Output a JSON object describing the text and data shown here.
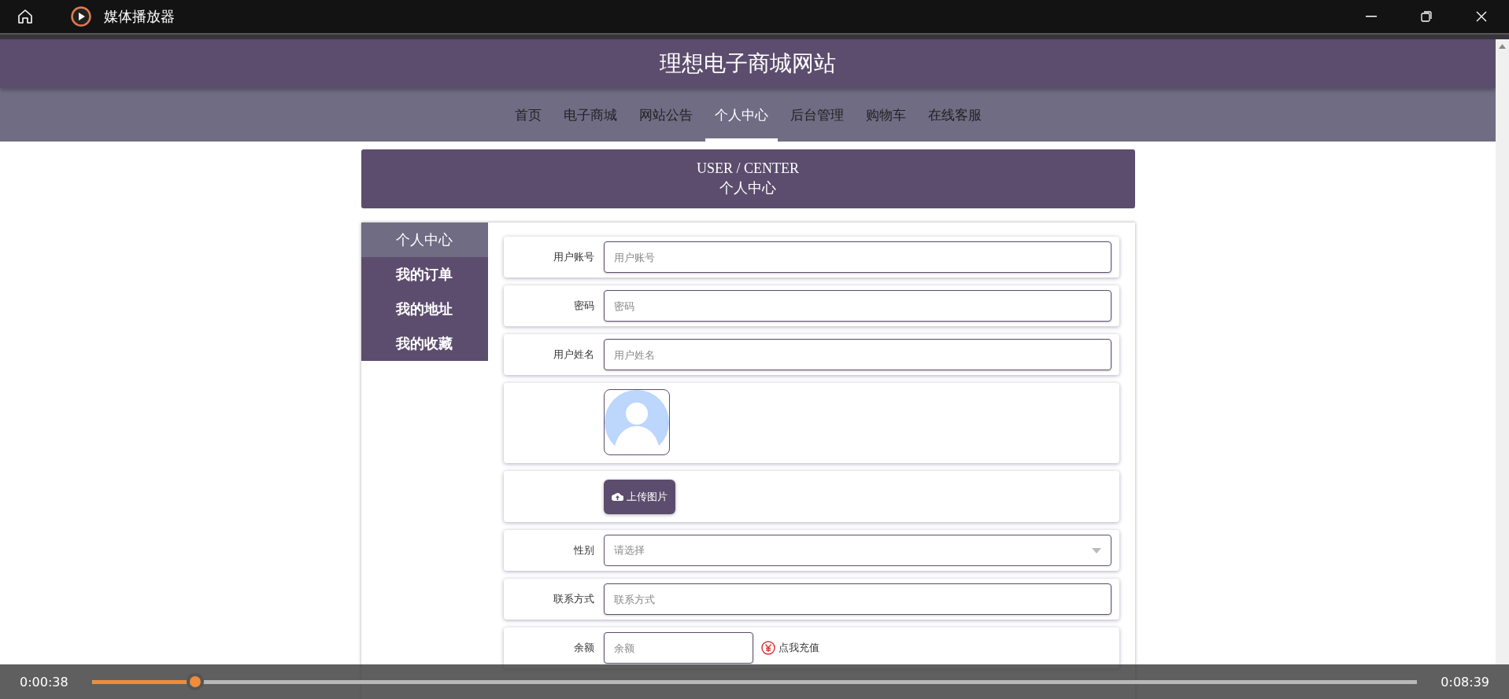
{
  "window": {
    "title": "媒体播放器"
  },
  "site": {
    "title": "理想电子商城网站",
    "nav": [
      {
        "label": "首页",
        "selected": false
      },
      {
        "label": "电子商城",
        "selected": false
      },
      {
        "label": "网站公告",
        "selected": false
      },
      {
        "label": "个人中心",
        "selected": true
      },
      {
        "label": "后台管理",
        "selected": false
      },
      {
        "label": "购物车",
        "selected": false
      },
      {
        "label": "在线客服",
        "selected": false
      }
    ],
    "banner": {
      "english": "USER / CENTER",
      "chinese": "个人中心"
    },
    "sidebar": [
      {
        "label": "个人中心",
        "selected": true
      },
      {
        "label": "我的订单",
        "selected": false
      },
      {
        "label": "我的地址",
        "selected": false
      },
      {
        "label": "我的收藏",
        "selected": false
      }
    ],
    "form": [
      {
        "kind": "text",
        "label": "用户账号",
        "placeholder": "用户账号"
      },
      {
        "kind": "text",
        "label": "密码",
        "placeholder": "密码"
      },
      {
        "kind": "text",
        "label": "用户姓名",
        "placeholder": "用户姓名"
      },
      {
        "kind": "avatar"
      },
      {
        "kind": "upload",
        "button": "上传图片"
      },
      {
        "kind": "select",
        "label": "性别",
        "placeholder": "请选择"
      },
      {
        "kind": "text",
        "label": "联系方式",
        "placeholder": "联系方式"
      },
      {
        "kind": "balance",
        "label": "余额",
        "placeholder": "余额",
        "link": "点我充值"
      }
    ]
  },
  "player": {
    "elapsed": "0:00:38",
    "total": "0:08:39",
    "level": 0.078
  }
}
